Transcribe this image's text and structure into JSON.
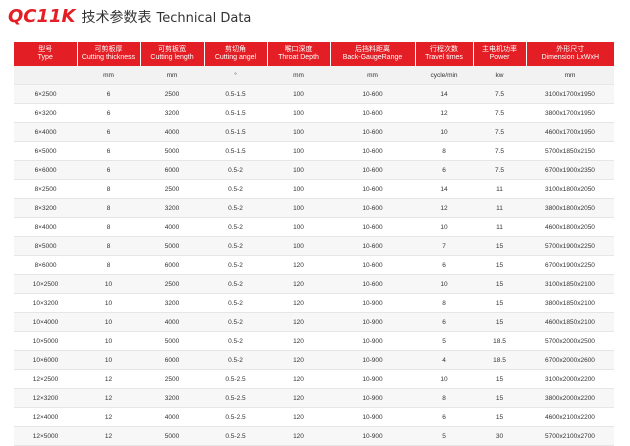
{
  "title": {
    "model": "QC11K",
    "cn": "技术参数表",
    "en": "Technical Data"
  },
  "table": {
    "headers": [
      {
        "cn": "型号",
        "en": "Type"
      },
      {
        "cn": "可剪板厚",
        "en": "Cutting thickness"
      },
      {
        "cn": "可剪板宽",
        "en": "Cutting length"
      },
      {
        "cn": "剪切角",
        "en": "Cutting angel"
      },
      {
        "cn": "喉口深度",
        "en": "Throat Depth"
      },
      {
        "cn": "后挡料距离",
        "en": "Back-GaugeRange"
      },
      {
        "cn": "行程次数",
        "en": "Travel times"
      },
      {
        "cn": "主电机功率",
        "en": "Power"
      },
      {
        "cn": "外形尺寸",
        "en": "Dimension LxWxH"
      }
    ],
    "units": [
      "",
      "mm",
      "mm",
      "°",
      "mm",
      "mm",
      "cycle/min",
      "kw",
      "mm"
    ],
    "rows": [
      [
        "6×2500",
        "6",
        "2500",
        "0.5-1.5",
        "100",
        "10-600",
        "14",
        "7.5",
        "3100x1700x1950"
      ],
      [
        "6×3200",
        "6",
        "3200",
        "0.5-1.5",
        "100",
        "10-600",
        "12",
        "7.5",
        "3800x1700x1950"
      ],
      [
        "6×4000",
        "6",
        "4000",
        "0.5-1.5",
        "100",
        "10-600",
        "10",
        "7.5",
        "4600x1700x1950"
      ],
      [
        "6×5000",
        "6",
        "5000",
        "0.5-1.5",
        "100",
        "10-600",
        "8",
        "7.5",
        "5700x1850x2150"
      ],
      [
        "6×6000",
        "6",
        "6000",
        "0.5-2",
        "100",
        "10-600",
        "6",
        "7.5",
        "6700x1900x2350"
      ],
      [
        "8×2500",
        "8",
        "2500",
        "0.5-2",
        "100",
        "10-600",
        "14",
        "11",
        "3100x1800x2050"
      ],
      [
        "8×3200",
        "8",
        "3200",
        "0.5-2",
        "100",
        "10-600",
        "12",
        "11",
        "3800x1800x2050"
      ],
      [
        "8×4000",
        "8",
        "4000",
        "0.5-2",
        "100",
        "10-600",
        "10",
        "11",
        "4600x1800x2050"
      ],
      [
        "8×5000",
        "8",
        "5000",
        "0.5-2",
        "100",
        "10-600",
        "7",
        "15",
        "5700x1900x2250"
      ],
      [
        "8×6000",
        "8",
        "6000",
        "0.5-2",
        "120",
        "10-600",
        "6",
        "15",
        "6700x1900x2250"
      ],
      [
        "10×2500",
        "10",
        "2500",
        "0.5-2",
        "120",
        "10-600",
        "10",
        "15",
        "3100x1850x2100"
      ],
      [
        "10×3200",
        "10",
        "3200",
        "0.5-2",
        "120",
        "10-900",
        "8",
        "15",
        "3800x1850x2100"
      ],
      [
        "10×4000",
        "10",
        "4000",
        "0.5-2",
        "120",
        "10-900",
        "6",
        "15",
        "4600x1850x2100"
      ],
      [
        "10×5000",
        "10",
        "5000",
        "0.5-2",
        "120",
        "10-900",
        "5",
        "18.5",
        "5700x2000x2500"
      ],
      [
        "10×6000",
        "10",
        "6000",
        "0.5-2",
        "120",
        "10-900",
        "4",
        "18.5",
        "6700x2000x2600"
      ],
      [
        "12×2500",
        "12",
        "2500",
        "0.5-2.5",
        "120",
        "10-900",
        "10",
        "15",
        "3100x2000x2200"
      ],
      [
        "12×3200",
        "12",
        "3200",
        "0.5-2.5",
        "120",
        "10-900",
        "8",
        "15",
        "3800x2000x2200"
      ],
      [
        "12×4000",
        "12",
        "4000",
        "0.5-2.5",
        "120",
        "10-900",
        "6",
        "15",
        "4600x2100x2200"
      ],
      [
        "12×5000",
        "12",
        "5000",
        "0.5-2.5",
        "120",
        "10-900",
        "5",
        "30",
        "5700x2100x2700"
      ]
    ]
  },
  "colors": {
    "accent": "#e31e24",
    "header_text": "#ffffff"
  }
}
